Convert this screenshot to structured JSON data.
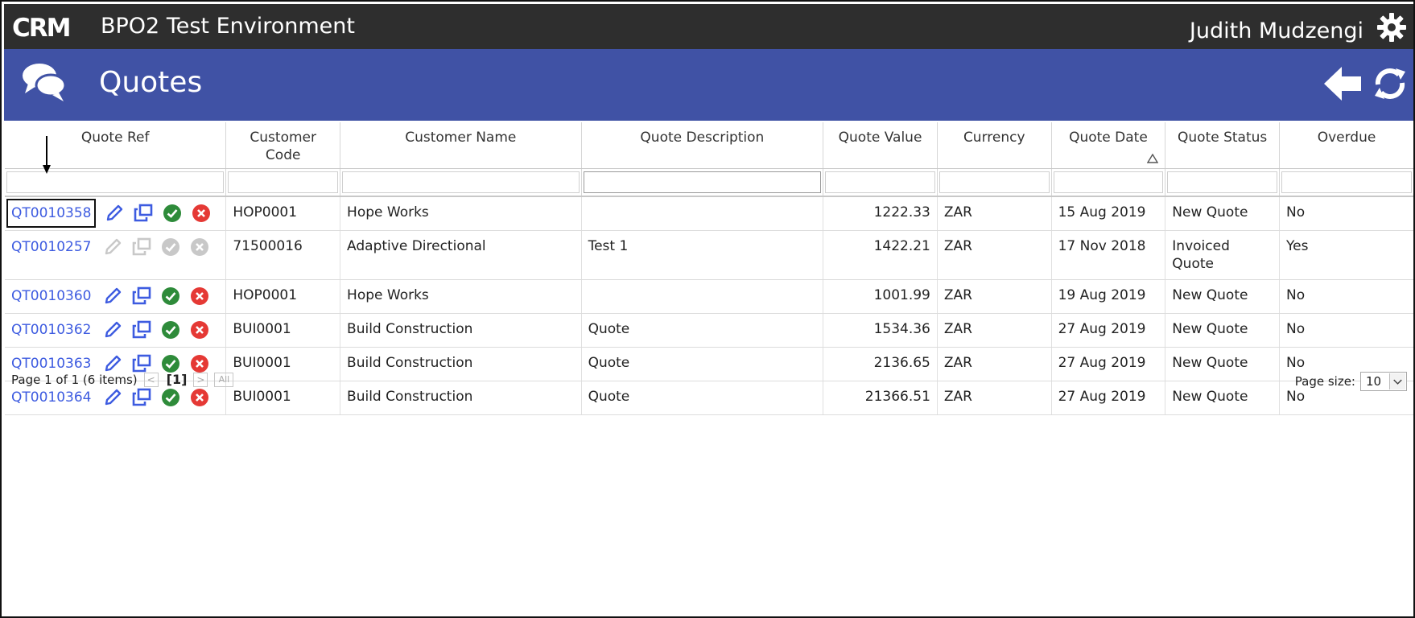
{
  "app": {
    "logo_text": "CRM",
    "environment": "BPO2 Test Environment",
    "user": "Judith Mudzengi"
  },
  "page": {
    "title": "Quotes"
  },
  "grid": {
    "columns": [
      "Quote Ref",
      "Customer Code",
      "Customer Name",
      "Quote Description",
      "Quote Value",
      "Currency",
      "Quote Date",
      "Quote Status",
      "Overdue"
    ],
    "rows": [
      {
        "ref": "QT0010358",
        "code": "HOP0001",
        "name": "Hope Works",
        "desc": "",
        "value": "1222.33",
        "currency": "ZAR",
        "date": "15 Aug 2019",
        "status": "New Quote",
        "overdue": "No",
        "enabled": true
      },
      {
        "ref": "QT0010257",
        "code": "71500016",
        "name": "Adaptive Directional",
        "desc": "Test 1",
        "value": "1422.21",
        "currency": "ZAR",
        "date": "17 Nov 2018",
        "status": "Invoiced Quote",
        "overdue": "Yes",
        "enabled": false
      },
      {
        "ref": "QT0010360",
        "code": "HOP0001",
        "name": "Hope Works",
        "desc": "",
        "value": "1001.99",
        "currency": "ZAR",
        "date": "19 Aug 2019",
        "status": "New Quote",
        "overdue": "No",
        "enabled": true
      },
      {
        "ref": "QT0010362",
        "code": "BUI0001",
        "name": "Build Construction",
        "desc": "Quote",
        "value": "1534.36",
        "currency": "ZAR",
        "date": "27 Aug 2019",
        "status": "New Quote",
        "overdue": "No",
        "enabled": true
      },
      {
        "ref": "QT0010363",
        "code": "BUI0001",
        "name": "Build Construction",
        "desc": "Quote",
        "value": "2136.65",
        "currency": "ZAR",
        "date": "27 Aug 2019",
        "status": "New Quote",
        "overdue": "No",
        "enabled": true
      },
      {
        "ref": "QT0010364",
        "code": "BUI0001",
        "name": "Build Construction",
        "desc": "Quote",
        "value": "21366.51",
        "currency": "ZAR",
        "date": "27 Aug 2019",
        "status": "New Quote",
        "overdue": "No",
        "enabled": true
      }
    ]
  },
  "pager": {
    "summary": "Page 1 of 1 (6 items)",
    "prev": "<",
    "current": "[1]",
    "next": ">",
    "all": "All",
    "page_size_label": "Page size:",
    "page_size_value": "10"
  },
  "colors": {
    "topbar": "#2e2e2e",
    "pagebar": "#4052a5",
    "link": "#3d5be0",
    "approve": "#2e8b3a",
    "reject": "#e53935",
    "disabled": "#c8c8c8"
  },
  "icons": {
    "header": [
      "chat-bubbles-icon",
      "back-arrow-icon",
      "refresh-icon",
      "gear-icon"
    ],
    "row_actions": [
      "edit-pencil-icon",
      "copy-icon",
      "approve-check-icon",
      "reject-x-icon"
    ]
  }
}
